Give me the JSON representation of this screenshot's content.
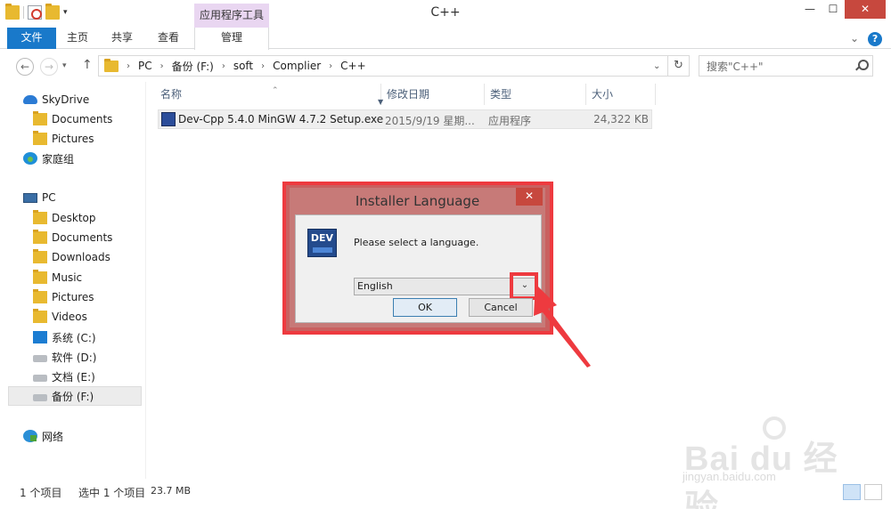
{
  "window": {
    "title": "C++",
    "tool_context": "应用程序工具",
    "minimize": "—",
    "maximize": "☐",
    "close": "✕"
  },
  "ribbon": {
    "tabs": [
      {
        "label": "文件"
      },
      {
        "label": "主页"
      },
      {
        "label": "共享"
      },
      {
        "label": "查看"
      },
      {
        "label": "管理"
      }
    ],
    "expand": "⌄",
    "help": "?"
  },
  "address": {
    "crumbs": [
      "PC",
      "备份 (F:)",
      "soft",
      "Complier",
      "C++"
    ],
    "search_placeholder": "搜索\"C++\""
  },
  "nav_pane": {
    "favorites": [
      {
        "label": "SkyDrive",
        "icon": "cloud-icon"
      },
      {
        "label": "Documents",
        "icon": "folder-icon"
      },
      {
        "label": "Pictures",
        "icon": "folder-icon"
      },
      {
        "label": "家庭组",
        "icon": "homegroup-icon"
      }
    ],
    "pc": [
      {
        "label": "PC",
        "icon": "pc-icon"
      },
      {
        "label": "Desktop",
        "icon": "folder-icon"
      },
      {
        "label": "Documents",
        "icon": "folder-icon"
      },
      {
        "label": "Downloads",
        "icon": "folder-icon"
      },
      {
        "label": "Music",
        "icon": "folder-icon"
      },
      {
        "label": "Pictures",
        "icon": "folder-icon"
      },
      {
        "label": "Videos",
        "icon": "folder-icon"
      },
      {
        "label": "系统 (C:)",
        "icon": "system-drive-icon"
      },
      {
        "label": "软件 (D:)",
        "icon": "drive-icon"
      },
      {
        "label": "文档 (E:)",
        "icon": "drive-icon"
      },
      {
        "label": "备份 (F:)",
        "icon": "drive-icon",
        "selected": true
      }
    ],
    "network": {
      "label": "网络",
      "icon": "network-icon"
    }
  },
  "file_list": {
    "columns": [
      "名称",
      "修改日期",
      "类型",
      "大小"
    ],
    "rows": [
      {
        "name": "Dev-Cpp 5.4.0 MinGW 4.7.2 Setup.exe",
        "date": "2015/9/19 星期...",
        "type": "应用程序",
        "size": "24,322 KB"
      }
    ]
  },
  "status": {
    "count": "1 个项目",
    "selected": "选中 1 个项目",
    "size": "23.7 MB"
  },
  "dialog": {
    "title": "Installer Language",
    "close": "✕",
    "message": "Please select a language.",
    "logo": "DEV",
    "selected_language": "English",
    "ok": "OK",
    "cancel": "Cancel",
    "highlight_color": "#ee3a3f"
  },
  "watermark": {
    "main": "Bai du 经验",
    "sub": "jingyan.baidu.com"
  }
}
